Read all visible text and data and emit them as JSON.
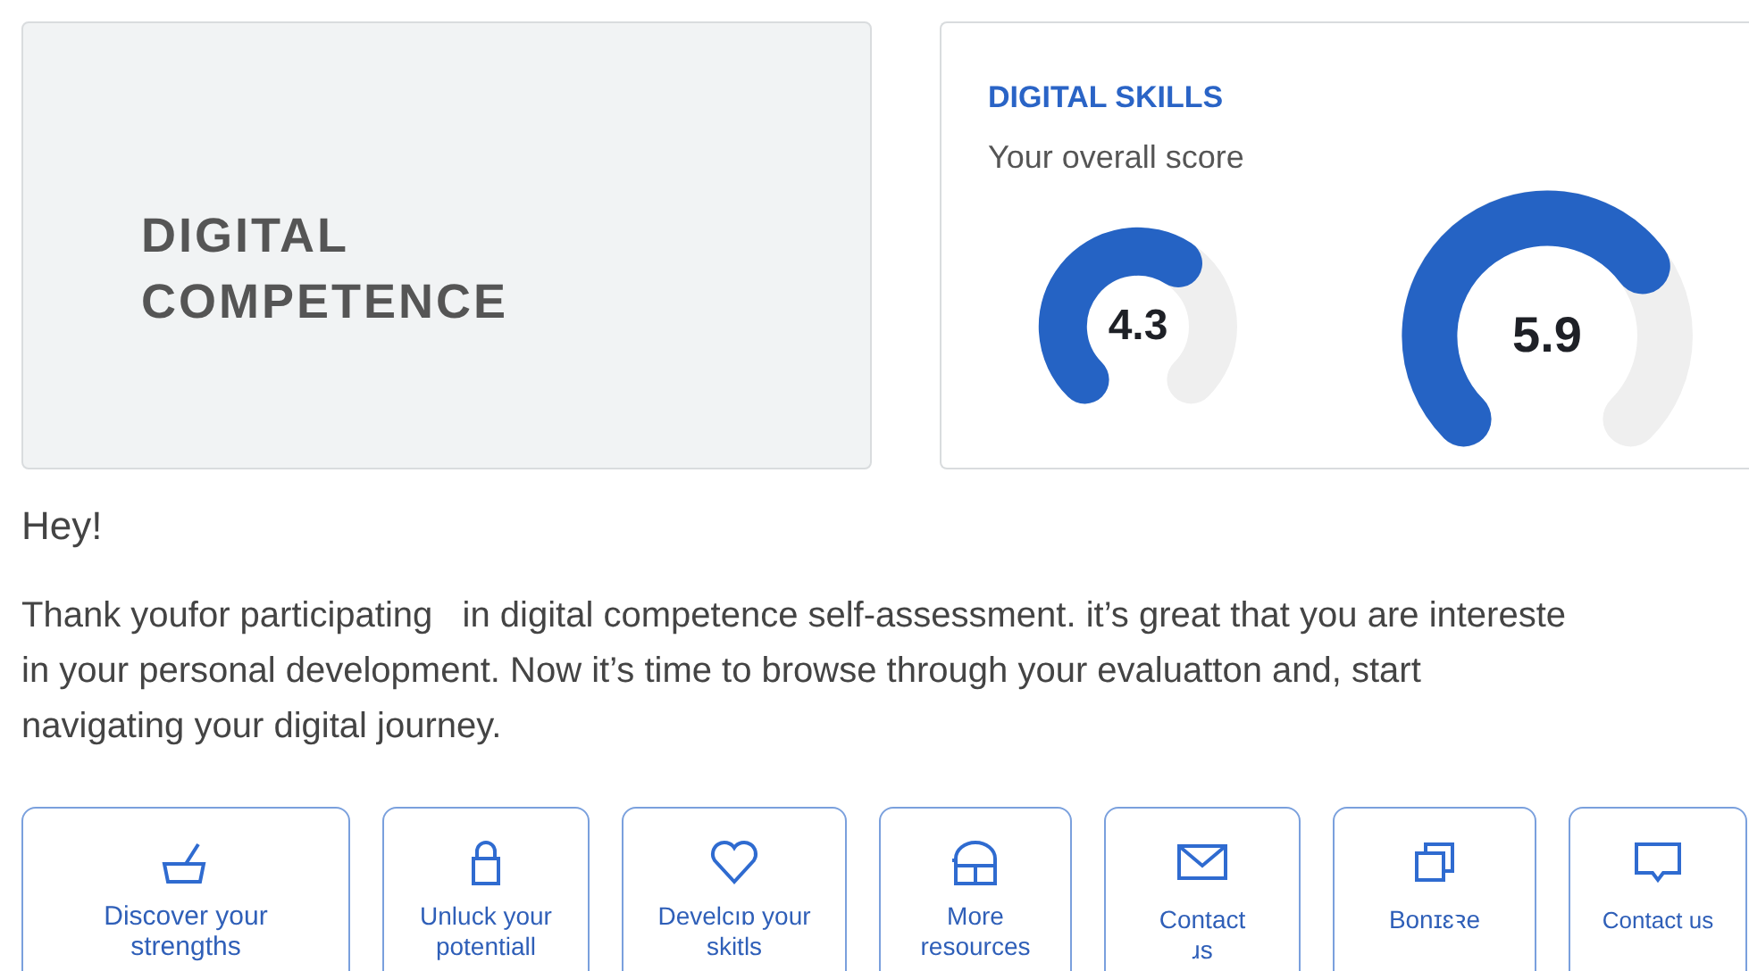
{
  "hero": {
    "title_lines": [
      "DIGITAL",
      "COMPETENCE"
    ]
  },
  "skills": {
    "heading": "DIGITAL SKILLS",
    "subtitle": "Your overall score",
    "gauges": [
      {
        "reading": "4.3"
      },
      {
        "reading": "5.9"
      }
    ]
  },
  "greeting": "Hey!",
  "intro_lines": [
    "Thank youfor participating   in digital competence self-assessment. it’s great that you are intereste",
    "in your personal development. Now it’s time to browse through your evaluatton and, start",
    "navigating your digital journey."
  ],
  "cards": [
    {
      "label_lines": [
        "Discover your",
        "strengths"
      ]
    },
    {
      "label_lines": [
        "Unluck your",
        "potentiall"
      ]
    },
    {
      "label_lines": [
        "Develcıɒ your",
        "skitls"
      ]
    },
    {
      "label_lines": [
        "More",
        "resources"
      ]
    },
    {
      "label_lines": [
        "Contact",
        "ɹs"
      ]
    },
    {
      "label_lines": [
        "Bonɪɛꝛe"
      ]
    },
    {
      "label_lines": [
        "Contact us"
      ]
    }
  ]
}
